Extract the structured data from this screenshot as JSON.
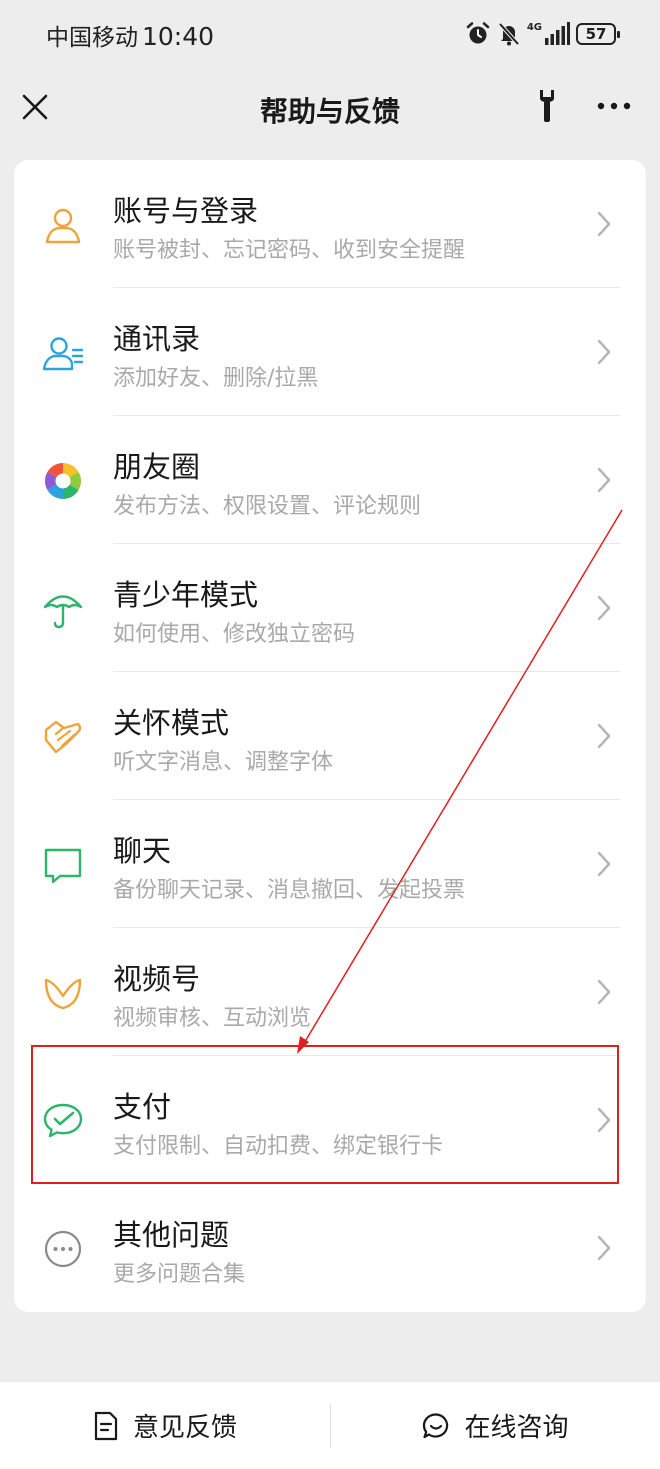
{
  "status_bar": {
    "carrier": "中国移动",
    "time": "10:40",
    "network": "4G",
    "battery": "57"
  },
  "nav": {
    "title": "帮助与反馈"
  },
  "items": [
    {
      "title": "账号与登录",
      "desc": "账号被封、忘记密码、收到安全提醒",
      "icon": "user-icon",
      "color": "#f0a23b"
    },
    {
      "title": "通讯录",
      "desc": "添加好友、删除/拉黑",
      "icon": "contacts-icon",
      "color": "#2aa3e0"
    },
    {
      "title": "朋友圈",
      "desc": "发布方法、权限设置、评论规则",
      "icon": "moments-icon",
      "color": "#f5a623"
    },
    {
      "title": "青少年模式",
      "desc": "如何使用、修改独立密码",
      "icon": "umbrella-icon",
      "color": "#2fb56b"
    },
    {
      "title": "关怀模式",
      "desc": "听文字消息、调整字体",
      "icon": "care-icon",
      "color": "#f0a23b"
    },
    {
      "title": "聊天",
      "desc": "备份聊天记录、消息撤回、发起投票",
      "icon": "chat-bubble-icon",
      "color": "#2fb56b"
    },
    {
      "title": "视频号",
      "desc": "视频审核、互动浏览",
      "icon": "channels-icon",
      "color": "#f0a23b"
    },
    {
      "title": "支付",
      "desc": "支付限制、自动扣费、绑定银行卡",
      "icon": "pay-icon",
      "color": "#2fb56b"
    },
    {
      "title": "其他问题",
      "desc": "更多问题合集",
      "icon": "more-circle-icon",
      "color": "#8a8a8a"
    }
  ],
  "bottom": {
    "feedback_label": "意见反馈",
    "consult_label": "在线咨询"
  },
  "annotation": {
    "highlighted_item": "支付",
    "color": "#e02020"
  }
}
